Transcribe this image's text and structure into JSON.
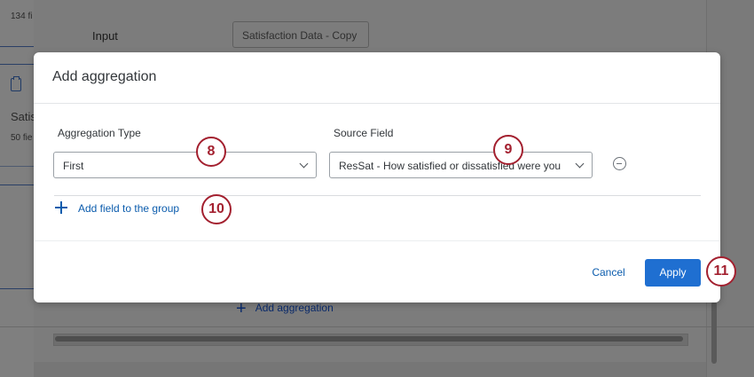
{
  "background": {
    "file_count_top": "134 fi",
    "input_label": "Input",
    "input_value": "Satisfaction Data - Copy",
    "card_name": "Satis",
    "file_count_card": "50 fie",
    "add_aggregation_label": "Add aggregation"
  },
  "modal": {
    "title": "Add aggregation",
    "aggregation_type_label": "Aggregation Type",
    "aggregation_type_value": "First",
    "source_field_label": "Source Field",
    "source_field_value": "ResSat - How satisfied or dissatisfied were you",
    "add_field_label": "Add field to the group",
    "cancel_label": "Cancel",
    "apply_label": "Apply"
  },
  "callouts": [
    "8",
    "9",
    "10",
    "11"
  ],
  "colors": {
    "accent": "#1f6fd1",
    "link": "#0b5cad",
    "callout": "#a3202f",
    "overlay": "#7f7f7f"
  }
}
